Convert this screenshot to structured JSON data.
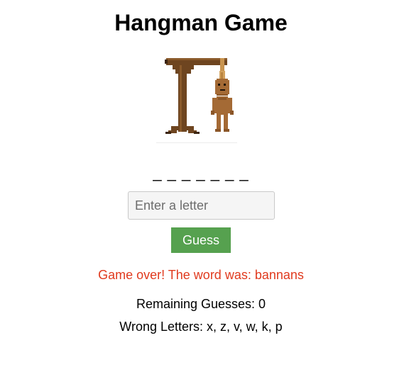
{
  "game": {
    "title": "Hangman Game",
    "word_display": "_ _ _ _ _ _ _",
    "input_placeholder": "Enter a letter",
    "input_value": "",
    "guess_button_label": "Guess",
    "status_message": "Game over! The word was: bannans",
    "remaining_label": "Remaining Guesses: 0",
    "wrong_letters_label": "Wrong Letters: x, z, v, w, k, p"
  },
  "colors": {
    "button": "#56a14f",
    "status": "#e03a1e",
    "wood": "#6e4520",
    "rope": "#d4a25e",
    "figure": "#a46a35"
  },
  "icons": {
    "gallows": "hangman-gallows-pixel-art"
  }
}
